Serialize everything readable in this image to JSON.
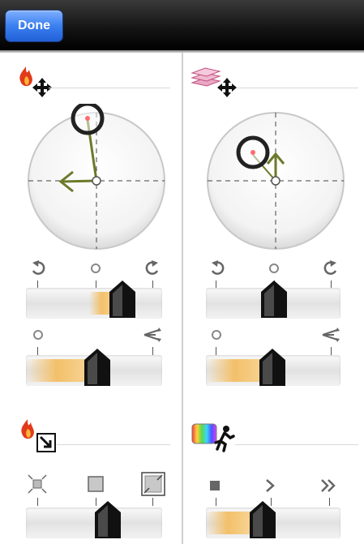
{
  "toolbar": {
    "done_label": "Done"
  },
  "colors": {
    "accent_orange": "#f3c06a",
    "arrow_green": "#6b7a2a",
    "ring_dark": "#222222",
    "button_blue": "#3b7ff0"
  },
  "left_panel": {
    "header_icons": [
      "flame-icon",
      "move-icon"
    ],
    "dial": {
      "icons": [
        "dial-ring-handle",
        "direction-arrow-icon"
      ]
    },
    "rotation_slider": {
      "icons": [
        "rotate-left-icon",
        "center-zero-icon",
        "rotate-right-icon"
      ],
      "value": 0.66
    },
    "spread_slider": {
      "icons": [
        "zero-icon",
        "scatter-icon"
      ],
      "value": 0.48
    },
    "size_header_icons": [
      "flame-icon",
      "resize-icon"
    ],
    "size_slider": {
      "icons": [
        "shrink-icon",
        "square-icon",
        "expand-icon"
      ],
      "value": 0.57
    }
  },
  "right_panel": {
    "header_icons": [
      "layers-icon",
      "move-icon"
    ],
    "dial": {
      "icons": [
        "dial-ring-handle",
        "direction-arrow-icon"
      ]
    },
    "rotation_slider": {
      "icons": [
        "rotate-left-icon",
        "center-zero-icon",
        "rotate-right-icon"
      ],
      "value": 0.5
    },
    "spread_slider": {
      "icons": [
        "zero-icon",
        "scatter-icon"
      ],
      "value": 0.5
    },
    "speed_header_icons": [
      "color-spectrum-icon",
      "runner-icon"
    ],
    "speed_slider": {
      "icons": [
        "stop-icon",
        "play-icon",
        "fast-forward-icon"
      ],
      "value": 0.4
    }
  }
}
